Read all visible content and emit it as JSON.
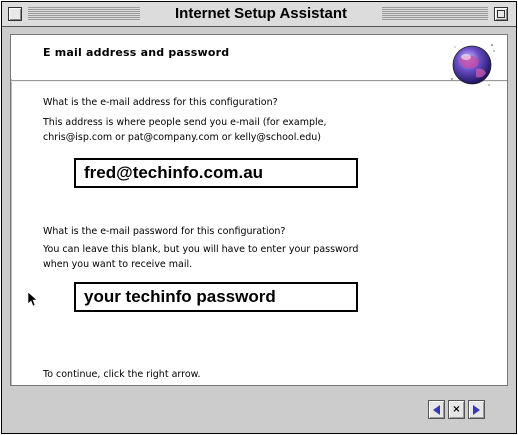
{
  "window": {
    "title": "Internet Setup Assistant"
  },
  "section": {
    "title": "E mail address and password"
  },
  "email": {
    "question": "What is the e-mail address for this configuration?",
    "help": "This address is where people send you e-mail (for example,\nchris@isp.com or pat@company.com or kelly@school.edu)",
    "value": "fred@techinfo.com.au"
  },
  "password": {
    "question": "What is the e-mail password for this configuration?",
    "help": "You can leave this blank, but you will have to enter your password\nwhen you want to receive mail.",
    "value": "your techinfo password"
  },
  "footer": {
    "instruction": "To continue, click the right arrow.",
    "back_icon": "left-arrow-icon",
    "cancel_icon": "x-icon",
    "forward_icon": "right-arrow-icon"
  },
  "colors": {
    "title_bar": "#dcdcdc",
    "window_frame": "#cccccc",
    "nav_arrow": "#3a3ab0"
  }
}
